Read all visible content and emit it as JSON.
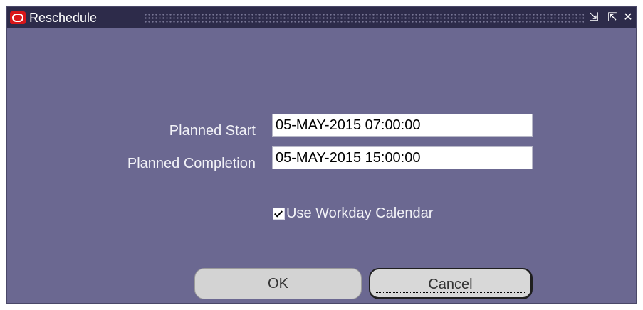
{
  "window": {
    "title": "Reschedule"
  },
  "form": {
    "planned_start": {
      "label": "Planned Start",
      "value": "05-MAY-2015 07:00:00"
    },
    "planned_completion": {
      "label": "Planned Completion",
      "value": "05-MAY-2015 15:00:00"
    },
    "use_workday_calendar": {
      "label": "Use Workday Calendar",
      "checked": true
    }
  },
  "buttons": {
    "ok": "OK",
    "cancel": "Cancel"
  },
  "icons": {
    "app": "oracle-logo-icon",
    "minimize": "minimize-icon",
    "maximize": "maximize-icon",
    "close": "close-icon"
  },
  "colors": {
    "window_background": "#6b6891",
    "titlebar_background": "#2d2b4a",
    "logo_red": "#d8161a"
  }
}
